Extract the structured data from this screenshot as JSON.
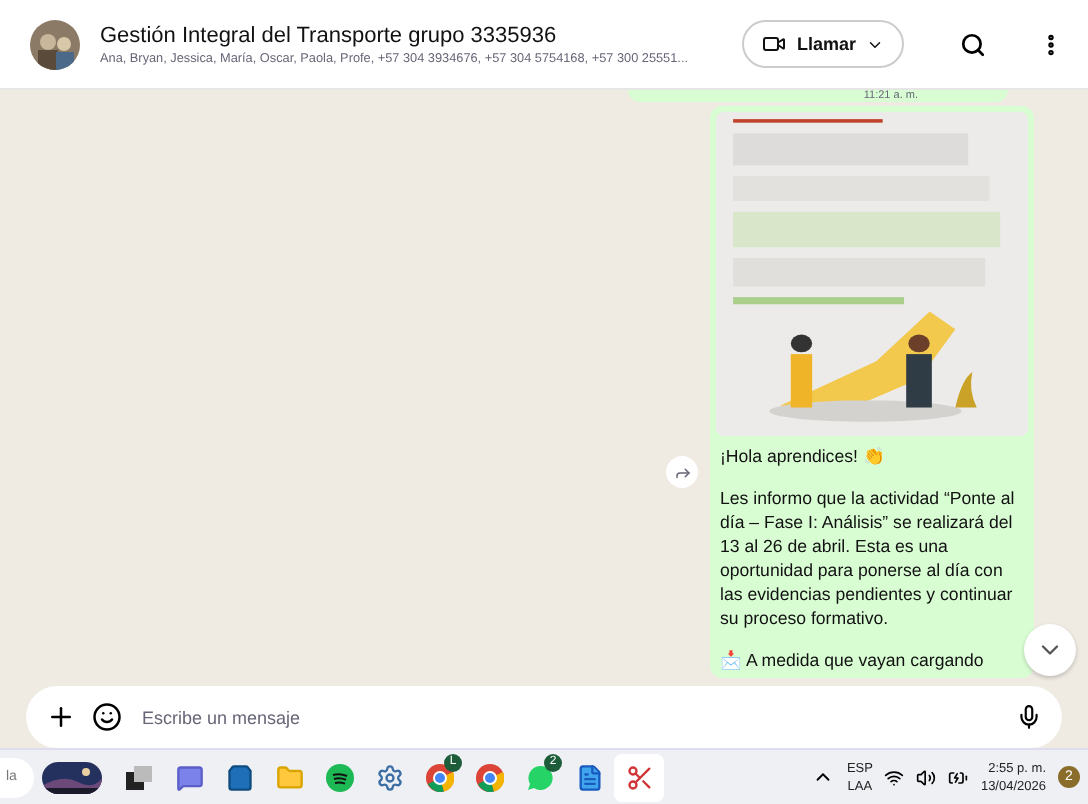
{
  "header": {
    "title": "Gestión Integral del Transporte grupo 3335936",
    "members": "Ana, Bryan, Jessica, María, Oscar, Paola, Profe, +57 304 3934676, +57 304 5754168, +57 300 25551...",
    "call_button": "Llamar"
  },
  "previous_message": {
    "time": "11:21 a. m."
  },
  "message": {
    "greeting": "¡Hola aprendices! 👏",
    "body": "Les informo que la actividad “Ponte al día – Fase I: Análisis” se realizará del 13 al 26 de abril. Esta es una oportunidad para ponerse al día con las evidencias pendientes y continuar su proceso formativo.",
    "next_line": "📩 A medida que vayan cargando"
  },
  "composer": {
    "placeholder": "Escribe un mensaje"
  },
  "taskbar": {
    "search_text": "la",
    "apps": [
      {
        "kind": "taskview",
        "selected": false
      },
      {
        "kind": "chat",
        "selected": false
      },
      {
        "kind": "store",
        "selected": false
      },
      {
        "kind": "folder",
        "selected": false
      },
      {
        "kind": "music",
        "selected": false
      },
      {
        "kind": "settings",
        "selected": false
      },
      {
        "kind": "browser",
        "badge": "L",
        "selected": false
      },
      {
        "kind": "browser",
        "selected": false
      },
      {
        "kind": "whatsapp",
        "badge": "2",
        "selected": false
      },
      {
        "kind": "word",
        "selected": false
      },
      {
        "kind": "snip",
        "selected": true
      }
    ],
    "language": "ESP",
    "layout": "LAA",
    "time": "2:55 p. m.",
    "date": "13/04/2026",
    "notifications": "2"
  }
}
